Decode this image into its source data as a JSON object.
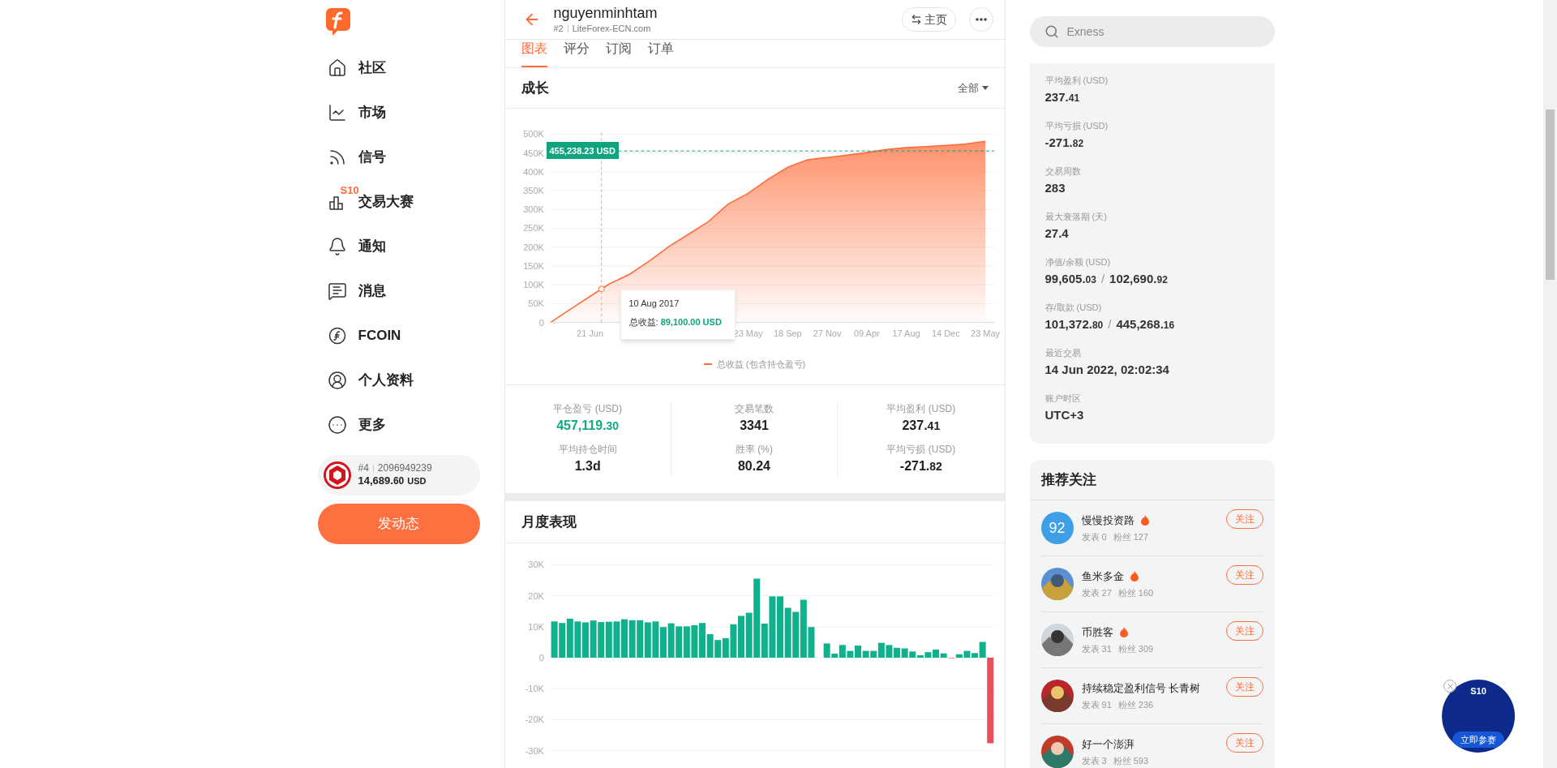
{
  "sidebar": {
    "items": [
      {
        "label": "社区",
        "selected": false
      },
      {
        "label": "市场",
        "selected": false
      },
      {
        "label": "信号",
        "selected": false
      },
      {
        "label": "交易大赛",
        "badge": "S10",
        "selected": false
      },
      {
        "label": "通知",
        "selected": false
      },
      {
        "label": "消息",
        "selected": false
      },
      {
        "label": "FCOIN",
        "selected": false
      },
      {
        "label": "个人资料",
        "selected": false
      },
      {
        "label": "更多",
        "selected": false
      }
    ],
    "account": {
      "rank": "#4",
      "id": "2096949239",
      "balance_whole": "14,689.",
      "balance_fraction": "60",
      "currency": "USD"
    },
    "post_button": "发动态"
  },
  "header": {
    "title": "nguyenminhtam",
    "rank": "#2",
    "broker": "LiteForex-ECN.com",
    "home_button": "主页"
  },
  "tabs": [
    {
      "label": "图表",
      "selected": true
    },
    {
      "label": "评分",
      "selected": false
    },
    {
      "label": "订阅",
      "selected": false
    },
    {
      "label": "订单",
      "selected": false
    }
  ],
  "growth": {
    "title": "成长",
    "filter": "全部",
    "tooltip": {
      "date": "10 Aug 2017",
      "label": "总收益: ",
      "value": "89,100.00 USD"
    },
    "chart_data": {
      "type": "area",
      "grid": true,
      "categories": [
        null,
        null,
        "21 Jun",
        null,
        null,
        null,
        null,
        null,
        null,
        null,
        "23 May",
        null,
        "18 Sep",
        null,
        "27 Nov",
        null,
        "09 Apr",
        null,
        "17 Aug",
        null,
        "14 Dec",
        null,
        "23 May"
      ],
      "series": [
        {
          "name": "总收益 (包含持仓盈亏)",
          "color": "#ff6d3b",
          "values": [
            0,
            35,
            69,
            103,
            128,
            163,
            202,
            235,
            268,
            315,
            343,
            380,
            412,
            432,
            438,
            444,
            451,
            459,
            464,
            467,
            470,
            474,
            481
          ]
        }
      ],
      "ylim": [
        0,
        500
      ],
      "ref_lines": [
        {
          "axis": "y",
          "value": 455.24,
          "label": "455,238.23 USD",
          "color": "#10a37f"
        }
      ],
      "yticks": [
        {
          "value": 0,
          "label": "0"
        },
        {
          "value": 50,
          "label": "50K"
        },
        {
          "value": 100,
          "label": "100K"
        },
        {
          "value": 150,
          "label": "150K"
        },
        {
          "value": 200,
          "label": "200K"
        },
        {
          "value": 250,
          "label": "250K"
        },
        {
          "value": 300,
          "label": "300K"
        },
        {
          "value": 350,
          "label": "350K"
        },
        {
          "value": 400,
          "label": "400K"
        },
        {
          "value": 450,
          "label": "450K"
        },
        {
          "value": 500,
          "label": "500K"
        }
      ]
    }
  },
  "summary": [
    {
      "label": "平仓盈亏 (USD)",
      "whole": "457,119.",
      "fraction": "30",
      "positive": true
    },
    {
      "label": "交易笔数",
      "whole": "3341",
      "positive": false
    },
    {
      "label": "平均盈利 (USD)",
      "whole": "237.",
      "fraction": "41",
      "positive": false
    },
    {
      "label": "平均持仓时间",
      "whole": "1.3d",
      "positive": false
    },
    {
      "label": "胜率 (%)",
      "whole": "80.24",
      "positive": false
    },
    {
      "label": "平均亏损 (USD)",
      "whole": "-271.",
      "fraction": "82",
      "positive": false
    }
  ],
  "monthly": {
    "chart_data": {
      "type": "bar",
      "title": "月度表现",
      "grid": true,
      "ylim": [
        -30,
        30
      ],
      "yticks": [
        {
          "value": 30,
          "label": "30K"
        },
        {
          "value": 20,
          "label": "20K"
        },
        {
          "value": 10,
          "label": "10K"
        },
        {
          "value": 0,
          "label": "0"
        },
        {
          "value": -10,
          "label": "-10K"
        },
        {
          "value": -20,
          "label": "-20K"
        },
        {
          "value": -30,
          "label": "-30K"
        }
      ],
      "series": [
        {
          "color": "#0fb28c",
          "values": [
            11.7,
            11.2,
            12.6,
            11.7,
            11.4,
            12.0,
            11.5,
            11.6,
            11.7,
            12.4,
            12.1,
            12.1,
            11.4,
            11.7,
            9.9,
            11.1,
            10.1,
            10.1,
            10.5,
            11.2,
            7.6,
            5.7,
            6.3,
            10.8,
            13.5,
            14.5,
            25.5,
            11.0,
            19.8,
            19.8,
            16.1,
            14.8,
            18.7,
            9.9,
            null,
            4.6,
            1.3,
            4.1,
            2.2,
            3.9,
            2.2,
            2.2,
            4.8,
            4.1,
            3.2,
            3.0,
            2.0,
            0.8,
            1.8,
            2.6,
            1.4,
            null,
            1.1,
            2.2,
            1.5,
            5.1,
            null
          ]
        },
        {
          "color": "#e8505b",
          "values": [
            null,
            null,
            null,
            null,
            null,
            null,
            null,
            null,
            null,
            null,
            null,
            null,
            null,
            null,
            null,
            null,
            null,
            null,
            null,
            null,
            null,
            null,
            null,
            null,
            null,
            null,
            null,
            null,
            null,
            null,
            null,
            null,
            null,
            null,
            null,
            null,
            null,
            null,
            null,
            null,
            null,
            null,
            null,
            null,
            null,
            null,
            null,
            null,
            null,
            null,
            null,
            -0.1,
            null,
            null,
            null,
            null,
            -27.6
          ]
        }
      ]
    }
  },
  "search": {
    "placeholder": "Exness"
  },
  "details": [
    {
      "label": "平均盈利 (USD)",
      "parts": [
        {
          "whole": "237.",
          "fraction": "41"
        }
      ]
    },
    {
      "label": "平均亏损 (USD)",
      "parts": [
        {
          "whole": "-271.",
          "fraction": "82"
        }
      ]
    },
    {
      "label": "交易周数",
      "parts": [
        {
          "whole": "283"
        }
      ]
    },
    {
      "label": "最大衰落期 (天)",
      "parts": [
        {
          "whole": "27.4"
        }
      ]
    },
    {
      "label": "净值/余额 (USD)",
      "separator": "/",
      "parts": [
        {
          "whole": "99,605.",
          "fraction": "03"
        },
        {
          "whole": "102,690.",
          "fraction": "92"
        }
      ]
    },
    {
      "label": "存/取款 (USD)",
      "separator": "/",
      "parts": [
        {
          "whole": "101,372.",
          "fraction": "80"
        },
        {
          "whole": "445,268.",
          "fraction": "16"
        }
      ]
    },
    {
      "label": "最近交易",
      "parts": [
        {
          "whole": "14 Jun 2022, 02:02:34"
        }
      ]
    },
    {
      "label": "账户时区",
      "parts": [
        {
          "whole": "UTC+3"
        }
      ]
    }
  ],
  "recommend": {
    "title": "推荐关注",
    "users": [
      {
        "kind": "text",
        "avatar_text": "92",
        "name": "慢慢投资路",
        "hot": true,
        "posts": "发表 0",
        "fans": "粉丝 127",
        "follow": "关注"
      },
      {
        "kind": "picture",
        "name": "鱼米多金",
        "hot": true,
        "posts": "发表 27",
        "fans": "粉丝 160",
        "follow": "关注"
      },
      {
        "kind": "picture",
        "name": "币胜客",
        "hot": true,
        "posts": "发表 31",
        "fans": "粉丝 309",
        "follow": "关注"
      },
      {
        "kind": "picture",
        "name": "持续稳定盈利信号 长青树",
        "hot": false,
        "posts": "发表 91",
        "fans": "粉丝 236",
        "follow": "关注"
      },
      {
        "kind": "picture",
        "name": "好一个澎湃",
        "hot": false,
        "posts": "发表 3",
        "fans": "粉丝 593",
        "follow": "关注"
      }
    ]
  },
  "promo": {
    "season": "S10",
    "action": "立即参赛"
  }
}
